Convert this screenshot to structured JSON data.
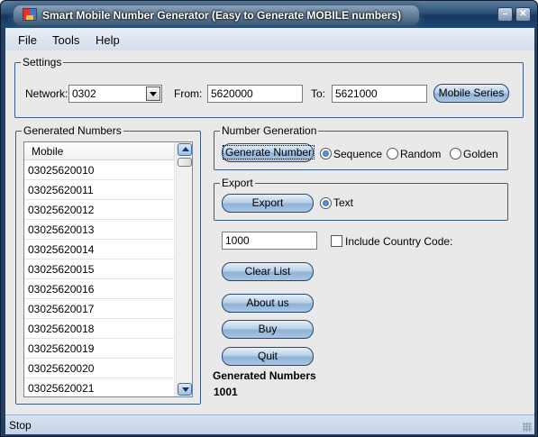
{
  "window": {
    "title": "Smart Mobile Number Generator (Easy to Generate MOBILE numbers)",
    "minimize_glyph": "–",
    "close_glyph": "✕"
  },
  "menu": {
    "items": [
      "File",
      "Tools",
      "Help"
    ]
  },
  "settings": {
    "legend": "Settings",
    "network_label": "Network:",
    "network_value": "0302",
    "from_label": "From:",
    "from_value": "5620000",
    "to_label": "To:",
    "to_value": "5621000",
    "series_button": "Mobile Series"
  },
  "generated": {
    "legend": "Generated Numbers",
    "column_header": "Mobile",
    "rows": [
      "03025620010",
      "03025620011",
      "03025620012",
      "03025620013",
      "03025620014",
      "03025620015",
      "03025620016",
      "03025620017",
      "03025620018",
      "03025620019",
      "03025620020",
      "03025620021"
    ]
  },
  "number_generation": {
    "legend": "Number Generation",
    "generate_button": "Generate Number",
    "options": [
      {
        "label": "Sequence",
        "checked": true
      },
      {
        "label": "Random",
        "checked": false
      },
      {
        "label": "Golden",
        "checked": false
      }
    ]
  },
  "export": {
    "legend": "Export",
    "export_button": "Export",
    "option_text": "Text",
    "option_text_checked": true
  },
  "count_value": "1000",
  "include_country_code": {
    "label": "Include Country Code:",
    "checked": false
  },
  "buttons": {
    "clear_list": "Clear List",
    "about_us": "About us",
    "buy": "Buy",
    "quit": "Quit"
  },
  "summary": {
    "label": "Generated Numbers",
    "value": "1001"
  },
  "status": {
    "text": "Stop"
  },
  "colors": {
    "title_bar": "#1f3f66",
    "button_face": "#b9d0e7",
    "client": "#e9e9e9"
  }
}
